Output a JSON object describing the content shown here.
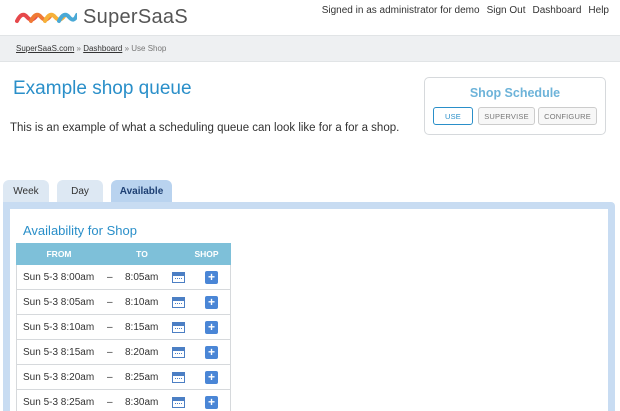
{
  "header": {
    "logo_text": "SuperSaaS",
    "nav": [
      "Signed in as administrator for demo",
      "Sign Out",
      "Dashboard",
      "Help"
    ]
  },
  "breadcrumb": {
    "items": [
      "SuperSaaS.com",
      "Dashboard",
      "Use Shop"
    ],
    "separator": "»"
  },
  "page": {
    "title": "Example shop queue",
    "intro": "This is an example of what a scheduling queue can look like for a for a shop."
  },
  "schedule": {
    "title": "Shop Schedule",
    "buttons": [
      "USE",
      "SUPERVISE",
      "CONFIGURE"
    ]
  },
  "tabs": [
    "Week",
    "Day",
    "Available"
  ],
  "availability": {
    "title": "Availability for Shop",
    "columns": [
      "FROM",
      "TO",
      "SHOP"
    ],
    "rows": [
      {
        "from": "Sun 5-3 8:00am",
        "dash": "–",
        "to": "8:05am"
      },
      {
        "from": "Sun 5-3 8:05am",
        "dash": "–",
        "to": "8:10am"
      },
      {
        "from": "Sun 5-3 8:10am",
        "dash": "–",
        "to": "8:15am"
      },
      {
        "from": "Sun 5-3 8:15am",
        "dash": "–",
        "to": "8:20am"
      },
      {
        "from": "Sun 5-3 8:20am",
        "dash": "–",
        "to": "8:25am"
      },
      {
        "from": "Sun 5-3 8:25am",
        "dash": "–",
        "to": "8:30am"
      }
    ],
    "plus_symbol": "+"
  },
  "colors": {
    "accent": "#2a8fc9",
    "table_header": "#7ec0d9",
    "tab_active": "#b9d3ef",
    "tab_inactive": "#dde8f3",
    "panel_border": "#c8dcf2",
    "icon_blue": "#4a86d6"
  }
}
